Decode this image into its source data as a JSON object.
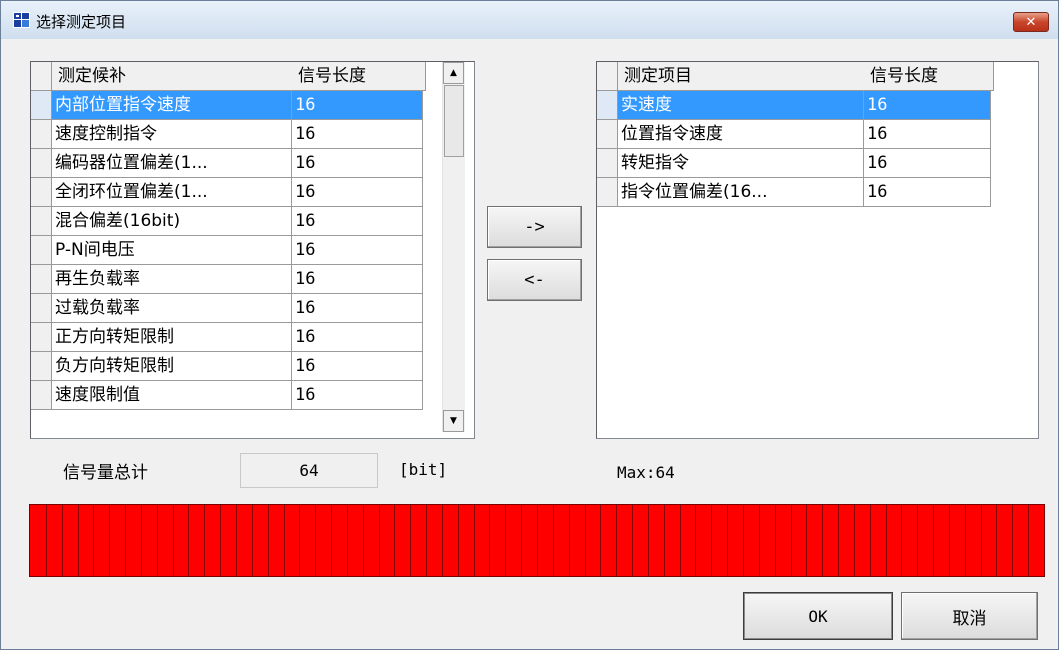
{
  "window": {
    "title": "选择测定项目",
    "close_glyph": "✕",
    "icon": "app-window-icon"
  },
  "candidates": {
    "headers": [
      "测定候补",
      "信号长度"
    ],
    "rows": [
      {
        "name": "内部位置指令速度",
        "len": "16",
        "selected": true
      },
      {
        "name": "速度控制指令",
        "len": "16"
      },
      {
        "name": "编码器位置偏差(1...",
        "len": "16"
      },
      {
        "name": "全闭环位置偏差(1...",
        "len": "16"
      },
      {
        "name": "混合偏差(16bit)",
        "len": "16"
      },
      {
        "name": "P-N间电压",
        "len": "16"
      },
      {
        "name": "再生负载率",
        "len": "16"
      },
      {
        "name": "过载负载率",
        "len": "16"
      },
      {
        "name": "正方向转矩限制",
        "len": "16"
      },
      {
        "name": "负方向转矩限制",
        "len": "16"
      },
      {
        "name": "速度限制值",
        "len": "16"
      }
    ],
    "scroll_up_glyph": "▲",
    "scroll_down_glyph": "▼"
  },
  "measured": {
    "headers": [
      "测定项目",
      "信号长度"
    ],
    "rows": [
      {
        "name": "实速度",
        "len": "16",
        "selected": true
      },
      {
        "name": "位置指令速度",
        "len": "16"
      },
      {
        "name": "转矩指令",
        "len": "16"
      },
      {
        "name": "指令位置偏差(16...",
        "len": "16"
      }
    ]
  },
  "buttons": {
    "add": "->",
    "remove": "<-",
    "ok": "OK",
    "cancel": "取消"
  },
  "total": {
    "label": "信号量总计",
    "value": "64",
    "unit": "[bit]",
    "max": "Max:64"
  },
  "usage_bar": {
    "filled_fraction": 1.0,
    "segments": 64,
    "fill_color": "#ff0000",
    "divider_color": "#8b0000"
  },
  "colors": {
    "selection": "#3399ff",
    "close_button": "#c9462a"
  }
}
